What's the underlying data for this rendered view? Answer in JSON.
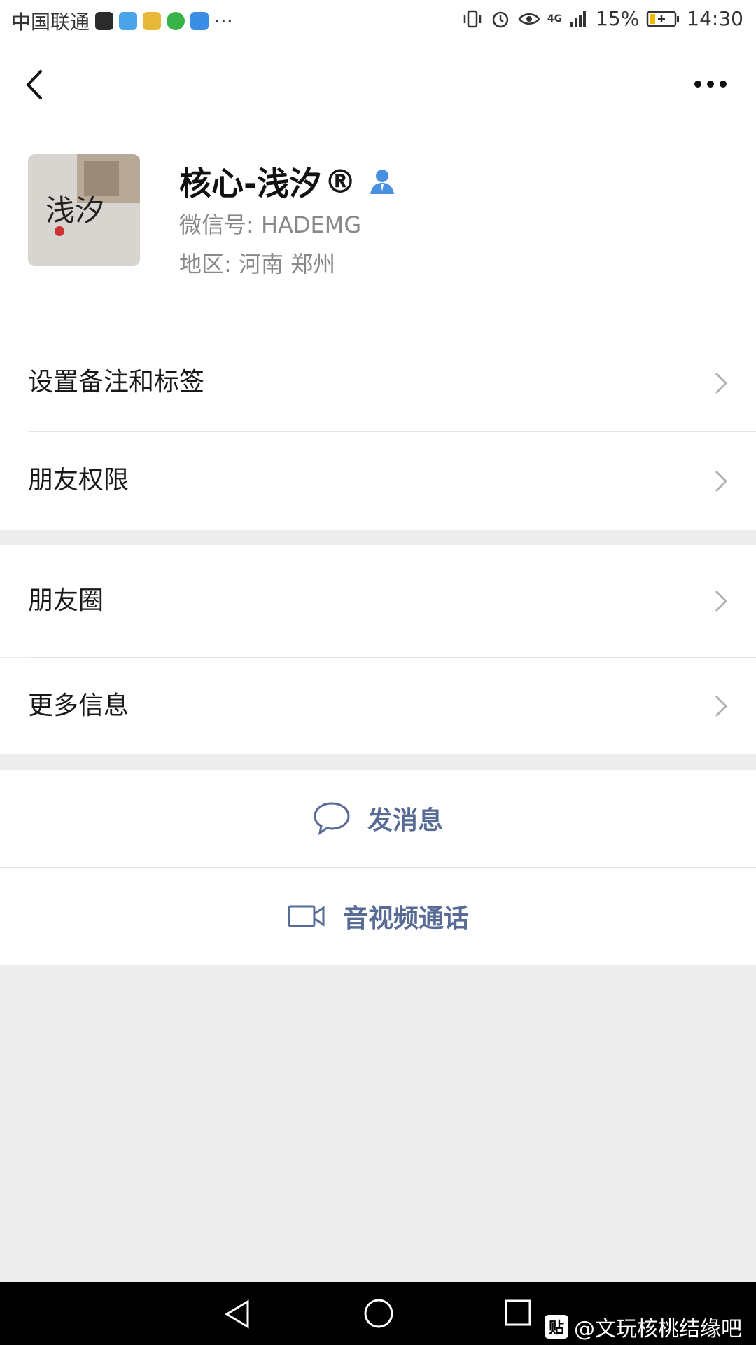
{
  "status_bar": {
    "carrier": "中国联通",
    "more_indicator": "···",
    "network": "4G",
    "battery": "15%",
    "time": "14:30",
    "app_icons": [
      "douyin-icon",
      "mail-icon",
      "drive-icon",
      "browser-icon",
      "tieba-icon"
    ],
    "app_colors": [
      "#2b2b2b",
      "#4aa3e8",
      "#e8b83a",
      "#37b34a",
      "#3a8ee6"
    ]
  },
  "contact": {
    "name": "核心-浅汐",
    "registered_mark": "®",
    "wechat_id": "微信号: HADEMG",
    "region": "地区: 河南  郑州",
    "avatar_text": "浅汐"
  },
  "menu": {
    "remark_tags": "设置备注和标签",
    "friend_permissions": "朋友权限",
    "moments": "朋友圈",
    "more_info": "更多信息"
  },
  "actions": {
    "send_message": "发消息",
    "video_call": "音视频通话"
  },
  "watermark": {
    "logo": "贴",
    "text": "@文玩核桃结缘吧"
  },
  "colors": {
    "link_blue": "#576b95",
    "background": "#ededed",
    "contact_icon": "#4a90e2"
  }
}
